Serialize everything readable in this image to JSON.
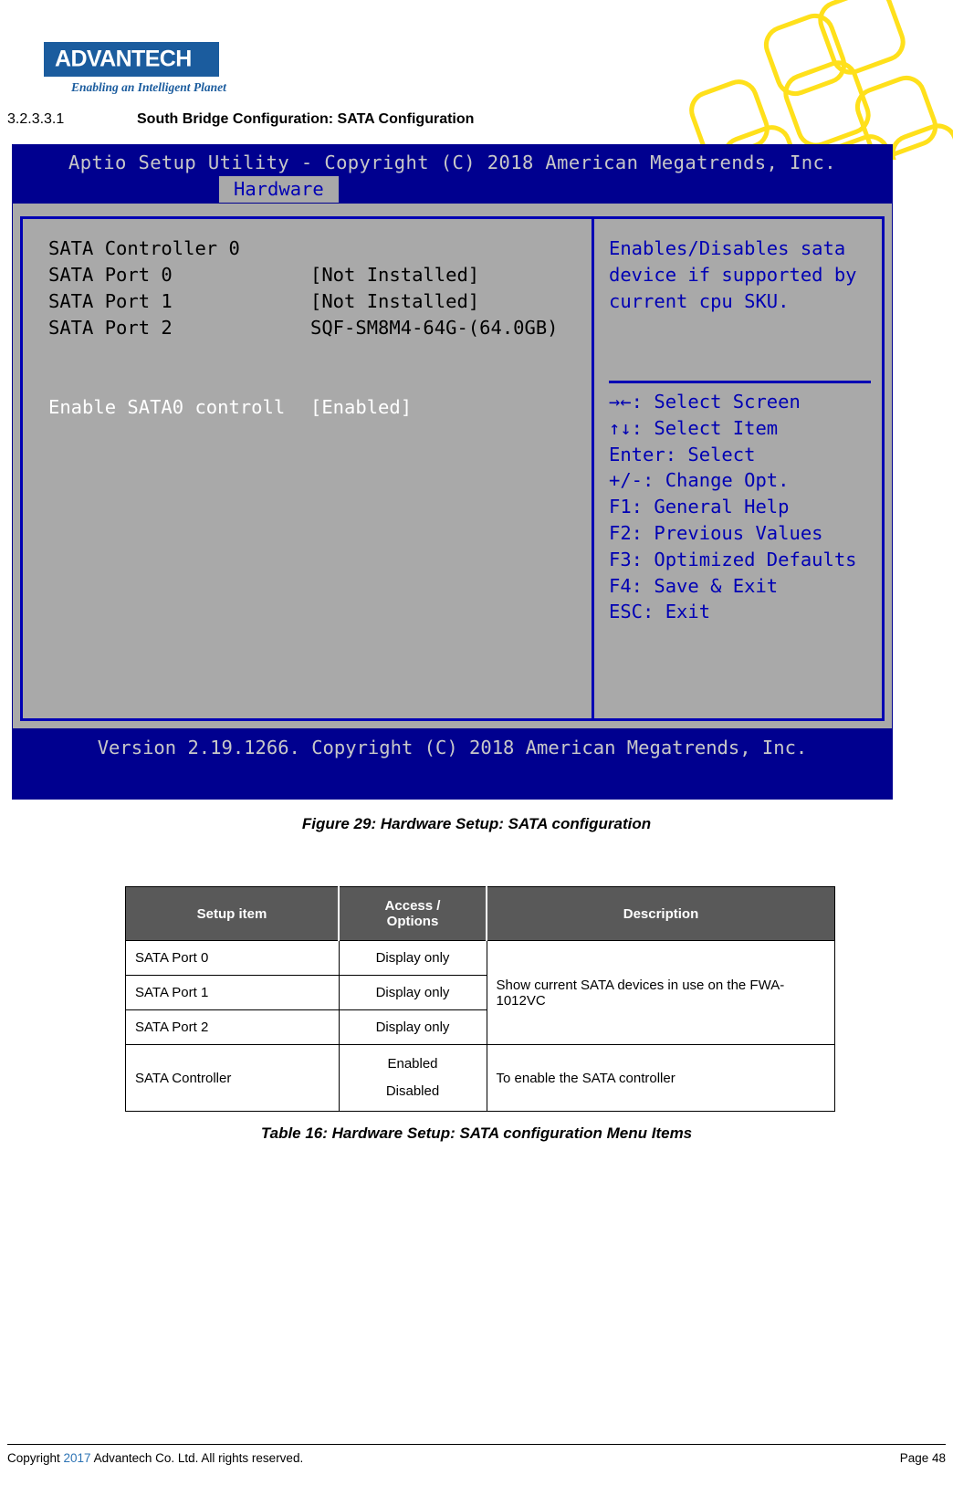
{
  "brand": {
    "logo_text": "ADVANTECH",
    "tagline": "Enabling an Intelligent Planet"
  },
  "section": {
    "number": "3.2.3.3.1",
    "title": "South Bridge Configuration: SATA Configuration"
  },
  "bios": {
    "title": "Aptio Setup Utility - Copyright (C) 2018 American Megatrends, Inc.",
    "tab": "Hardware",
    "items": [
      {
        "label": "SATA Controller 0",
        "value": "",
        "highlight": false
      },
      {
        "label": "SATA Port 0",
        "value": "[Not Installed]",
        "highlight": false
      },
      {
        "label": "SATA Port 1",
        "value": "[Not Installed]",
        "highlight": false
      },
      {
        "label": "SATA Port 2",
        "value": "SQF-SM8M4-64G-(64.0GB)",
        "highlight": false
      },
      {
        "label": "Enable SATA0 controll",
        "value": "[Enabled]",
        "highlight": true
      }
    ],
    "help_text": "Enables/Disables sata\ndevice if supported by\ncurrent cpu SKU.",
    "keys": [
      "→←: Select Screen",
      "↑↓: Select Item",
      "Enter: Select",
      "+/-: Change Opt.",
      "F1: General Help",
      "F2: Previous Values",
      "F3: Optimized Defaults",
      "F4: Save & Exit",
      "ESC: Exit"
    ],
    "footer": "Version 2.19.1266. Copyright (C) 2018 American Megatrends, Inc.",
    "colors": {
      "background": "#00008f",
      "panel": "#a9a9a9",
      "border": "#0000b4",
      "help": "#0000b4",
      "title": "#c8c8c8",
      "highlight_text": "#ffffff"
    }
  },
  "figure_caption": "Figure 29: Hardware Setup: SATA configuration",
  "table": {
    "headers": [
      "Setup item",
      "Access / Options",
      "Description"
    ],
    "header_access_line1": "Access /",
    "header_access_line2": "Options",
    "rows": [
      {
        "setup": "SATA Port 0",
        "access": "Display only",
        "description": "Show current SATA devices in use on the FWA-1012VC"
      },
      {
        "setup": "SATA Port 1",
        "access": "Display only"
      },
      {
        "setup": "SATA Port 2",
        "access": "Display only"
      },
      {
        "setup": "SATA Controller",
        "access_line1": "Enabled",
        "access_line2": "Disabled",
        "description": "To enable the SATA controller"
      }
    ]
  },
  "table_caption": "Table 16: Hardware Setup: SATA configuration Menu Items",
  "page_footer": {
    "copyright_prefix": "Copyright ",
    "year": "2017",
    "copyright_suffix": "  Advantech Co. Ltd. All rights reserved.",
    "page": "Page 48"
  }
}
